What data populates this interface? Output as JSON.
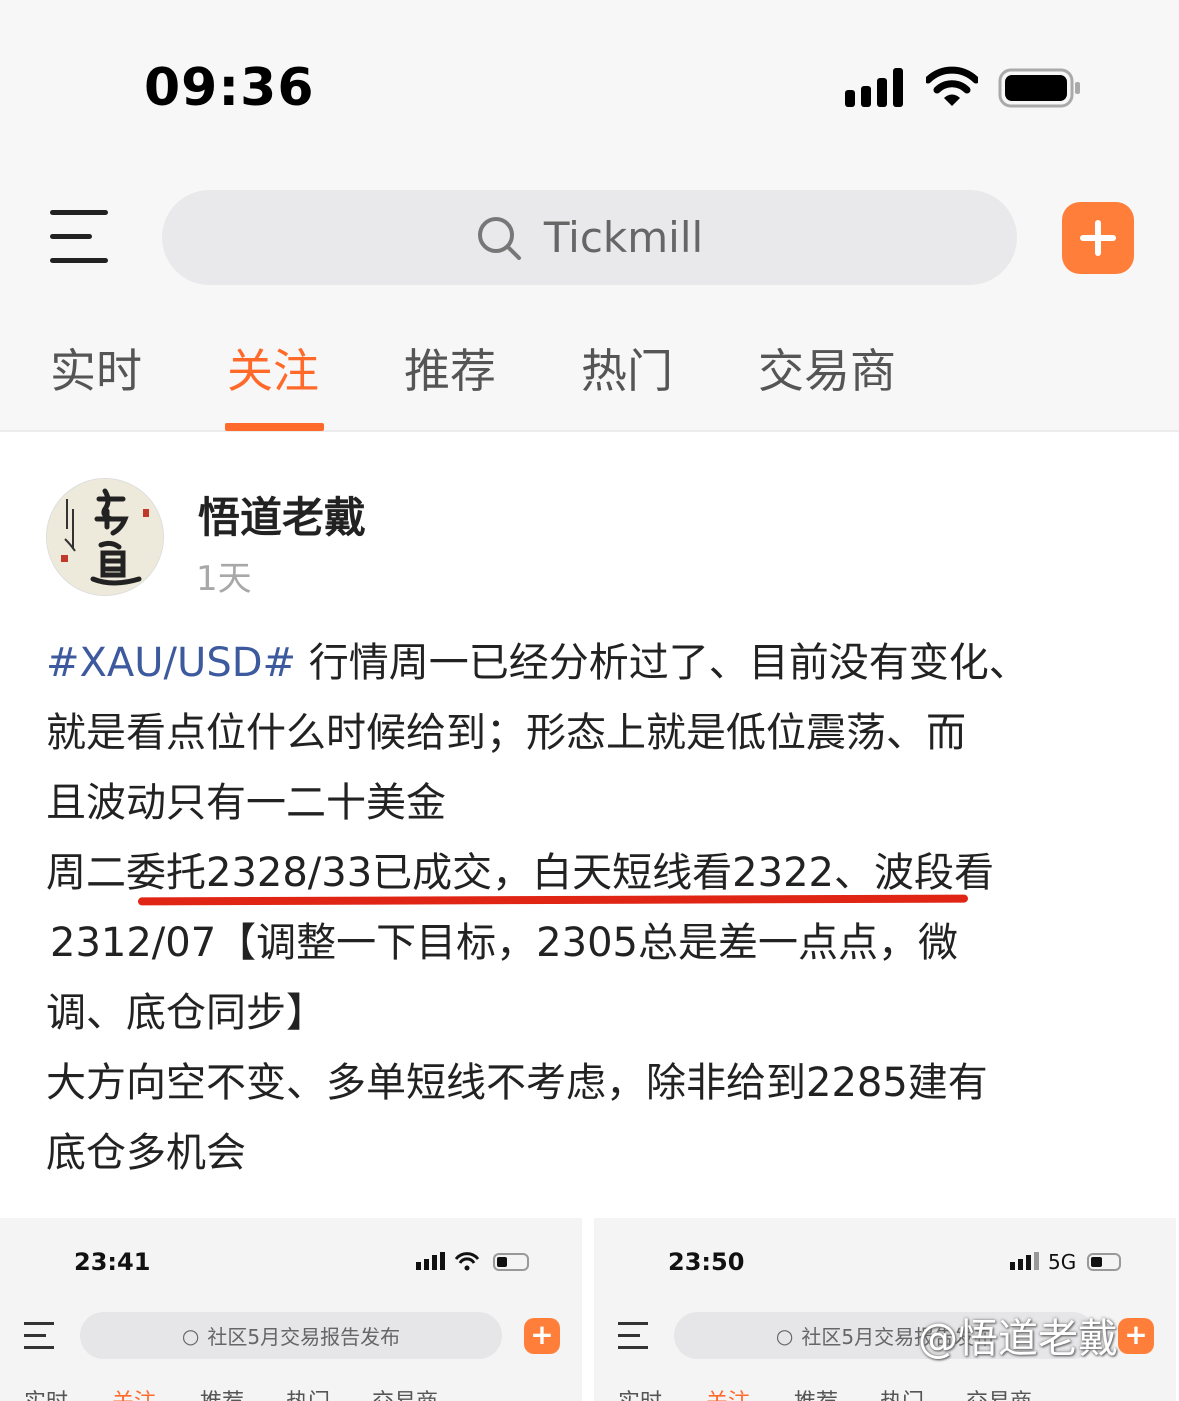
{
  "status_bar": {
    "time": "09:36"
  },
  "header": {
    "search_placeholder": "Tickmill",
    "tabs": [
      {
        "label": "实时"
      },
      {
        "label": "关注"
      },
      {
        "label": "推荐"
      },
      {
        "label": "热门"
      },
      {
        "label": "交易商"
      }
    ],
    "active_tab": "关注"
  },
  "post": {
    "author": "悟道老戴",
    "time": "1天",
    "hashtag": "#XAU/USD#",
    "lines": [
      " 行情周一已经分析过了、目前没有变化、",
      "就是看点位什么时候给到；形态上就是低位震荡、而",
      "且波动只有一二十美金",
      "周二委托2328/33已成交，白天短线看2322、波段看",
      "2312/07【调整一下目标，2305总是差一点点，微",
      "调、底仓同步】",
      "大方向空不变、多单短线不考虑，除非给到2285建有",
      "底仓多机会"
    ]
  },
  "thumbnails": [
    {
      "time": "23:41",
      "search": "社区5月交易报告发布",
      "tabs": [
        "实时",
        "关注",
        "推荐",
        "热门",
        "交易商"
      ]
    },
    {
      "time": "23:50",
      "network": "5G",
      "search": "社区5月交易报告发布",
      "tabs": [
        "实时",
        "关注",
        "推荐",
        "热门",
        "交易商"
      ]
    }
  ],
  "watermark": "@悟道老戴",
  "colors": {
    "accent": "#ff6a2b",
    "hashtag": "#3d5a9e",
    "underline": "#e02515"
  }
}
